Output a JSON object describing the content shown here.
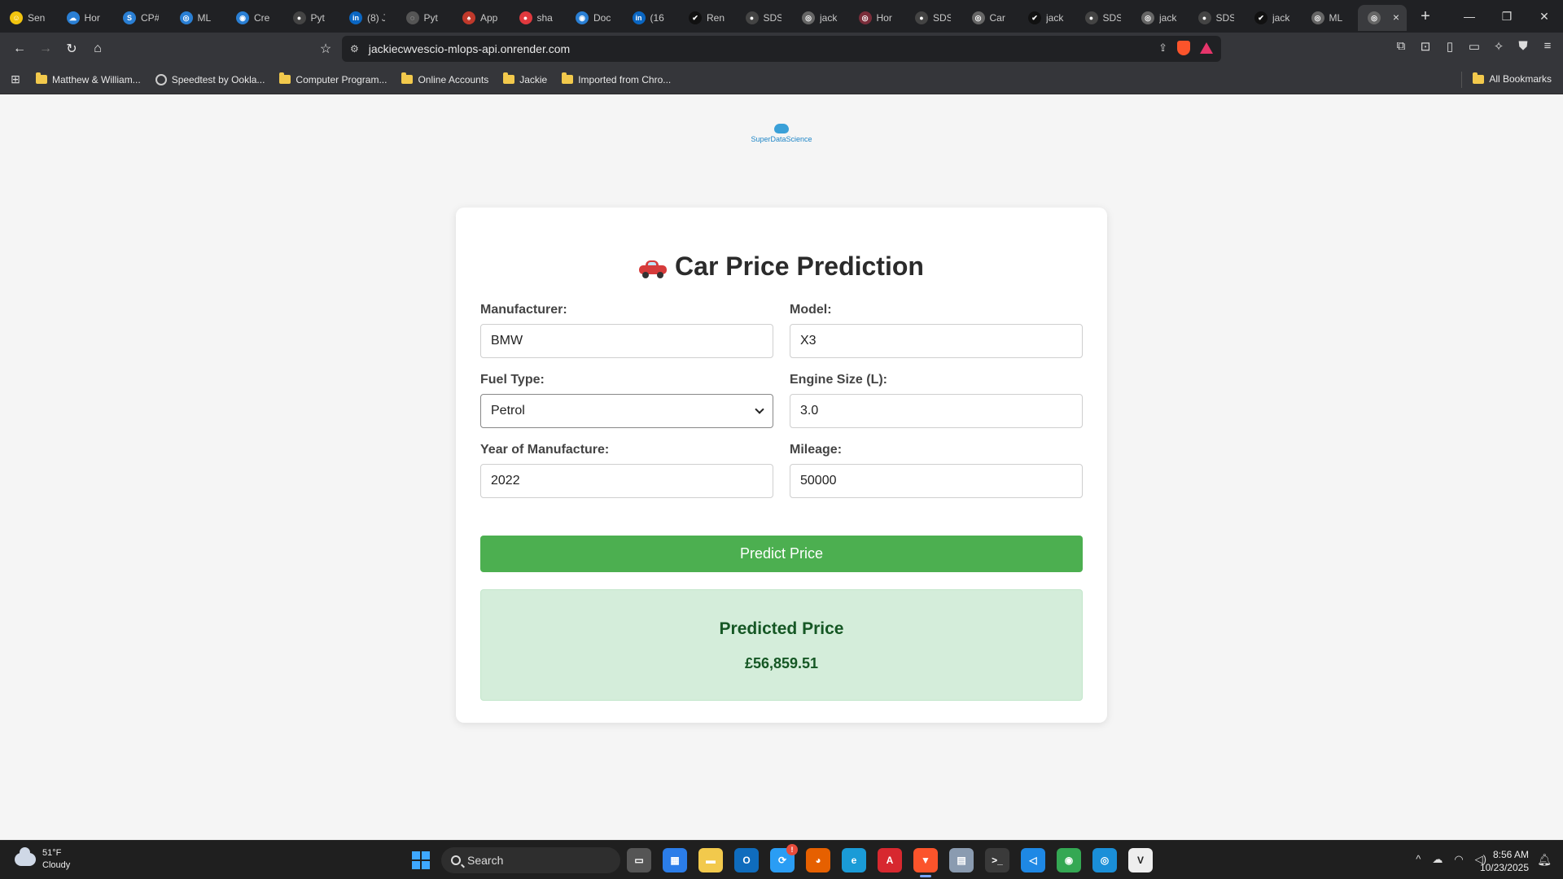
{
  "browser": {
    "tabs": [
      {
        "label": "Sen",
        "color": "#f1c40f",
        "glyph": "☺"
      },
      {
        "label": "Hor",
        "color": "#2a7fd4",
        "glyph": "☁"
      },
      {
        "label": "CP#",
        "color": "#2a7fd4",
        "glyph": "S"
      },
      {
        "label": "ML",
        "color": "#2a7fd4",
        "glyph": "◎"
      },
      {
        "label": "Cre",
        "color": "#2a7fd4",
        "glyph": "◉"
      },
      {
        "label": "Pyt",
        "color": "#444444",
        "glyph": "●"
      },
      {
        "label": "(8) J",
        "color": "#0a66c2",
        "glyph": "in"
      },
      {
        "label": "Pyt",
        "color": "#555555",
        "glyph": "◌"
      },
      {
        "label": "App",
        "color": "#c0392b",
        "glyph": "♠"
      },
      {
        "label": "sha",
        "color": "#e0393e",
        "glyph": "●"
      },
      {
        "label": "Doc",
        "color": "#2a7fd4",
        "glyph": "◉"
      },
      {
        "label": "(16",
        "color": "#0a66c2",
        "glyph": "in"
      },
      {
        "label": "Ren",
        "color": "#111111",
        "glyph": "✔"
      },
      {
        "label": "SDS",
        "color": "#444444",
        "glyph": "●"
      },
      {
        "label": "jack",
        "color": "#666666",
        "glyph": "◎"
      },
      {
        "label": "Hor",
        "color": "#7a2d3a",
        "glyph": "◎"
      },
      {
        "label": "SDS",
        "color": "#444444",
        "glyph": "●"
      },
      {
        "label": "Car",
        "color": "#666666",
        "glyph": "◎"
      },
      {
        "label": "jack",
        "color": "#111111",
        "glyph": "✔"
      },
      {
        "label": "SDS",
        "color": "#444444",
        "glyph": "●"
      },
      {
        "label": "jack",
        "color": "#666666",
        "glyph": "◎"
      },
      {
        "label": "SDS",
        "color": "#444444",
        "glyph": "●"
      },
      {
        "label": "jack",
        "color": "#111111",
        "glyph": "✔"
      },
      {
        "label": "ML",
        "color": "#666666",
        "glyph": "◎"
      }
    ],
    "active_tab": {
      "label": "",
      "glyph": "◎"
    },
    "new_tab_icon": "+",
    "window_controls": {
      "minimize": "—",
      "maximize": "❐",
      "close": "✕"
    },
    "nav": {
      "back": "←",
      "forward": "→",
      "reload": "↻",
      "home": "⌂",
      "bookmark": "☆"
    },
    "url": "jackiecwvescio-mlops-api.onrender.com",
    "toolbar_icons": [
      "⧉",
      "⊡",
      "▯",
      "▭",
      "✧",
      "⛊",
      "≡"
    ],
    "bookmarks": [
      {
        "label": "Matthew & William...",
        "icon": "folder"
      },
      {
        "label": "Speedtest by Ookla...",
        "icon": "gauge"
      },
      {
        "label": "Computer Program...",
        "icon": "folder"
      },
      {
        "label": "Online Accounts",
        "icon": "folder"
      },
      {
        "label": "Jackie",
        "icon": "folder"
      },
      {
        "label": "Imported from Chro...",
        "icon": "folder"
      }
    ],
    "all_bookmarks": "All Bookmarks"
  },
  "page": {
    "logo_text": "SuperDataScience",
    "title": "Car Price Prediction",
    "form": {
      "manufacturer_label": "Manufacturer:",
      "manufacturer_value": "BMW",
      "model_label": "Model:",
      "model_value": "X3",
      "fuel_label": "Fuel Type:",
      "fuel_value": "Petrol",
      "engine_label": "Engine Size (L):",
      "engine_value": "3.0",
      "year_label": "Year of Manufacture:",
      "year_value": "2022",
      "mileage_label": "Mileage:",
      "mileage_value": "50000"
    },
    "predict_button": "Predict Price",
    "result": {
      "title": "Predicted Price",
      "value": "£56,859.51"
    },
    "colors": {
      "button": "#4caf50",
      "result_bg": "#d4edda",
      "result_text": "#155724"
    }
  },
  "taskbar": {
    "weather_temp": "51°F",
    "weather_desc": "Cloudy",
    "search_placeholder": "Search",
    "apps": [
      {
        "name": "task-view",
        "color": "#555555",
        "glyph": "▭"
      },
      {
        "name": "store",
        "color": "#2b7de9",
        "glyph": "▦"
      },
      {
        "name": "file-explorer",
        "color": "#f2c94c",
        "glyph": "▬"
      },
      {
        "name": "outlook",
        "color": "#0f6cbd",
        "glyph": "O"
      },
      {
        "name": "app-badge",
        "color": "#2a9df4",
        "glyph": "⟳",
        "badge": "!"
      },
      {
        "name": "firefox",
        "color": "#e66000",
        "glyph": "◕"
      },
      {
        "name": "edge",
        "color": "#1a9bd7",
        "glyph": "e"
      },
      {
        "name": "acrobat",
        "color": "#d7282f",
        "glyph": "A"
      },
      {
        "name": "brave",
        "color": "#fb542b",
        "glyph": "▼",
        "active": true
      },
      {
        "name": "notepad",
        "color": "#8a9bb0",
        "glyph": "▤"
      },
      {
        "name": "terminal",
        "color": "#3a3a3a",
        "glyph": ">_"
      },
      {
        "name": "vscode",
        "color": "#1e88e5",
        "glyph": "◁"
      },
      {
        "name": "chrome",
        "color": "#34a853",
        "glyph": "◉"
      },
      {
        "name": "app-blue",
        "color": "#1a8fd8",
        "glyph": "◎"
      },
      {
        "name": "app-v",
        "color": "#eeeeee",
        "glyph": "V"
      }
    ],
    "tray_icons": [
      "^",
      "☁",
      "◠",
      "◁)"
    ],
    "time": "8:56 AM",
    "date": "10/23/2025"
  }
}
